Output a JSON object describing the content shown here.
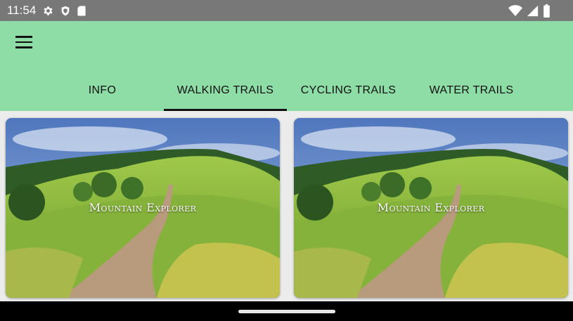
{
  "status_bar": {
    "time": "11:54",
    "left_icons": [
      "settings-gear-icon",
      "shield-icon",
      "sd-card-icon"
    ],
    "right_icons": [
      "wifi-icon",
      "cell-signal-icon",
      "battery-icon"
    ]
  },
  "app_bar": {
    "background": "#8edda7",
    "menu_icon": "hamburger-menu-icon",
    "tabs": [
      {
        "label": "INFO",
        "active": false
      },
      {
        "label": "WALKING TRAILS",
        "active": true
      },
      {
        "label": "CYCLING TRAILS",
        "active": false
      },
      {
        "label": "WATER TRAILS",
        "active": false
      }
    ]
  },
  "cards": [
    {
      "title": "Mountain Explorer",
      "image": "grassy hill trail landscape"
    },
    {
      "title": "Mountain Explorer",
      "image": "grassy hill trail landscape"
    }
  ]
}
